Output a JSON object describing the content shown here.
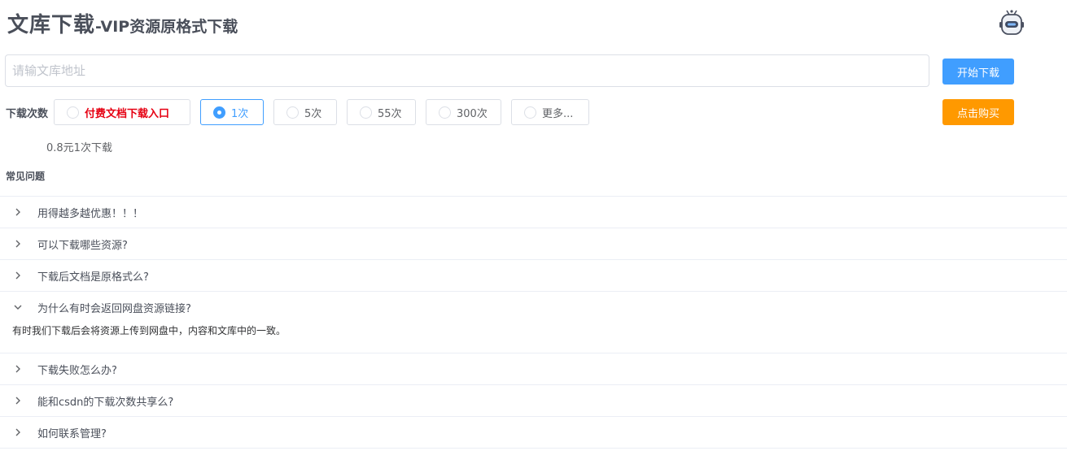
{
  "header": {
    "title_main": "文库下载",
    "title_sub": "-VIP资源原格式下载",
    "robot_icon": "robot-icon"
  },
  "search": {
    "placeholder": "请输文库地址",
    "value": ""
  },
  "buttons": {
    "start": "开始下载",
    "buy": "点击购买"
  },
  "colors": {
    "primary": "#409eff",
    "buy": "#ff9900",
    "paid_text": "#e60012"
  },
  "download_count": {
    "label": "下载次数",
    "options": [
      {
        "label": "付费文档下载入口",
        "checked": false
      },
      {
        "label": "1次",
        "checked": true
      },
      {
        "label": "5次",
        "checked": false
      },
      {
        "label": "55次",
        "checked": false
      },
      {
        "label": "300次",
        "checked": false
      },
      {
        "label": "更多...",
        "checked": false
      }
    ],
    "price_text": "0.8元1次下载"
  },
  "faq": {
    "title": "常见问题",
    "items": [
      {
        "question": "用得越多越优惠！！！",
        "expanded": false
      },
      {
        "question": "可以下载哪些资源?",
        "expanded": false
      },
      {
        "question": "下载后文档是原格式么?",
        "expanded": false
      },
      {
        "question": "为什么有时会返回网盘资源链接?",
        "expanded": true,
        "answer": "有时我们下载后会将资源上传到网盘中，内容和文库中的一致。"
      },
      {
        "question": "下载失败怎么办?",
        "expanded": false
      },
      {
        "question": "能和csdn的下载次数共享么?",
        "expanded": false
      },
      {
        "question": "如何联系管理?",
        "expanded": false
      }
    ]
  }
}
